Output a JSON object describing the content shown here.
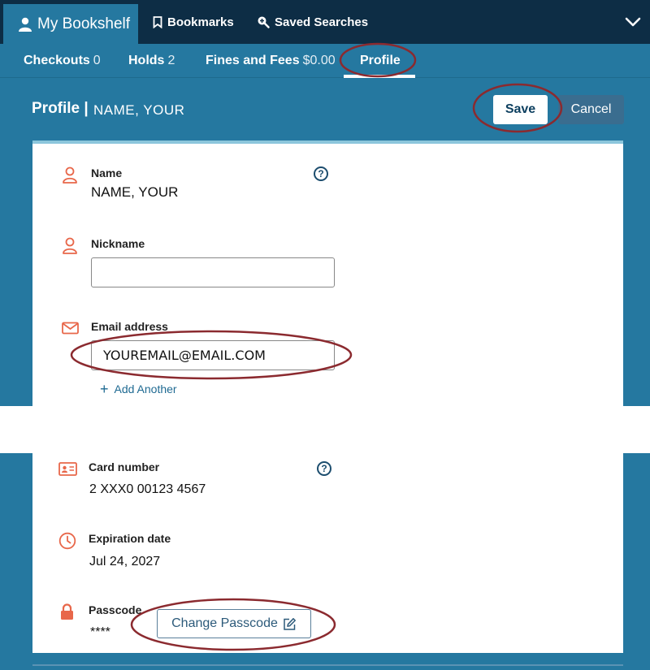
{
  "topnav": {
    "my_bookshelf": "My Bookshelf",
    "bookmarks": "Bookmarks",
    "saved_searches": "Saved Searches"
  },
  "subnav": {
    "checkouts_label": "Checkouts",
    "checkouts_count": "0",
    "holds_label": "Holds",
    "holds_count": "2",
    "fines_label": "Fines and Fees",
    "fines_amount": "$0.00",
    "profile_label": "Profile"
  },
  "header": {
    "title": "Profile |",
    "name": "NAME, YOUR",
    "save_label": "Save",
    "cancel_label": "Cancel"
  },
  "profile": {
    "name_label": "Name",
    "name_value": "NAME, YOUR",
    "nickname_label": "Nickname",
    "nickname_value": "",
    "email_label": "Email address",
    "email_value": "YOUREMAIL@EMAIL.COM",
    "add_another_label": "Add Another",
    "card_label": "Card number",
    "card_value": "2 XXX0 00123 4567",
    "expiration_label": "Expiration date",
    "expiration_value": "Jul 24, 2027",
    "passcode_label": "Passcode",
    "passcode_value": "****",
    "change_passcode_label": "Change Passcode",
    "help_glyph": "?"
  },
  "colors": {
    "nav_dark": "#0d2d45",
    "brand_blue": "#2578a0",
    "icon_orange": "#e8674a",
    "annotation": "#8b2a2f"
  },
  "icons": [
    "person-icon",
    "bookmark-icon",
    "search-plus-icon",
    "chevron-down-icon",
    "help-icon",
    "mail-icon",
    "id-card-icon",
    "clock-icon",
    "lock-icon",
    "edit-icon",
    "plus-icon"
  ]
}
